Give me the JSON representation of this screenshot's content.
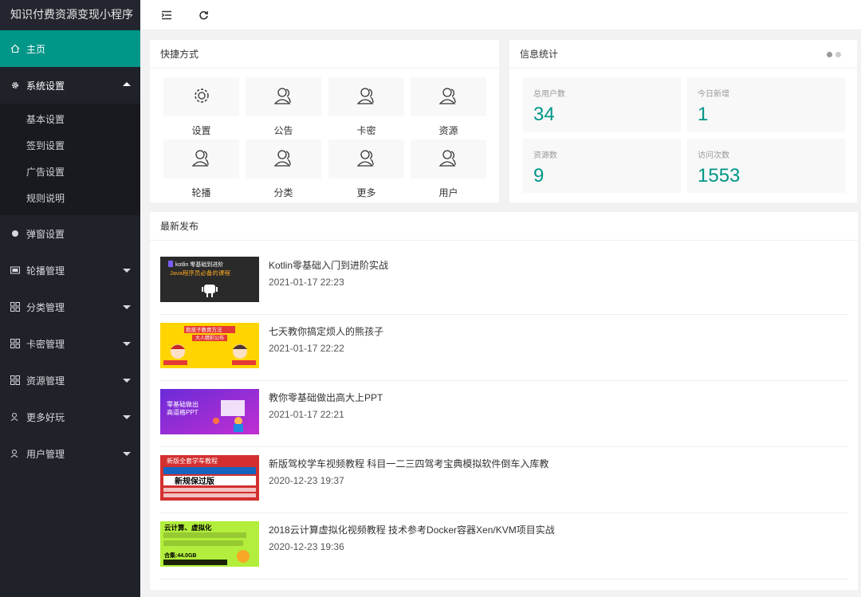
{
  "app": {
    "title": "知识付费资源变现小程序"
  },
  "sidebar": {
    "home": "主页",
    "system": "系统设置",
    "system_sub": [
      "基本设置",
      "签到设置",
      "广告设置",
      "规则说明"
    ],
    "popup": "弹窗设置",
    "carousel": "轮播管理",
    "category": "分类管理",
    "card": "卡密管理",
    "resource": "资源管理",
    "more": "更多好玩",
    "user": "用户管理"
  },
  "shortcuts": {
    "title": "快捷方式",
    "items": [
      "设置",
      "公告",
      "卡密",
      "资源",
      "轮播",
      "分类",
      "更多",
      "用户"
    ]
  },
  "stats": {
    "title": "信息统计",
    "items": [
      {
        "label": "总用户数",
        "value": "34"
      },
      {
        "label": "今日新增",
        "value": "1"
      },
      {
        "label": "资源数",
        "value": "9"
      },
      {
        "label": "访问次数",
        "value": "1553"
      }
    ]
  },
  "latest": {
    "title": "最新发布",
    "items": [
      {
        "title": "Kotlin零基础入门到进阶实战",
        "time": "2021-01-17 22:23",
        "thumb": {
          "line1": "kotlin 零基础到进阶",
          "line2": "Java程序员必备的课程"
        }
      },
      {
        "title": "七天教你搞定烦人的熊孩子",
        "time": "2021-01-17 22:22",
        "thumb": {
          "line1": "熊孩子教育方法",
          "line2": "大人精彩公布"
        }
      },
      {
        "title": "教你零基础做出高大上PPT",
        "time": "2021-01-17 22:21",
        "thumb": {
          "line1": "零基础做出",
          "line2": "高逼格PPT"
        }
      },
      {
        "title": "新版驾校学车视频教程 科目一二三四驾考宝典模拟软件倒车入库教",
        "time": "2020-12-23 19:37",
        "thumb": {
          "line1": "新版全套学车教程",
          "line2": "新规保过版"
        }
      },
      {
        "title": "2018云计算虚拟化视频教程 技术参考Docker容器Xen/KVM项目实战",
        "time": "2020-12-23 19:36",
        "thumb": {
          "line1": "云计算、虚拟化",
          "line2": "合集:44.0GB"
        }
      }
    ]
  }
}
